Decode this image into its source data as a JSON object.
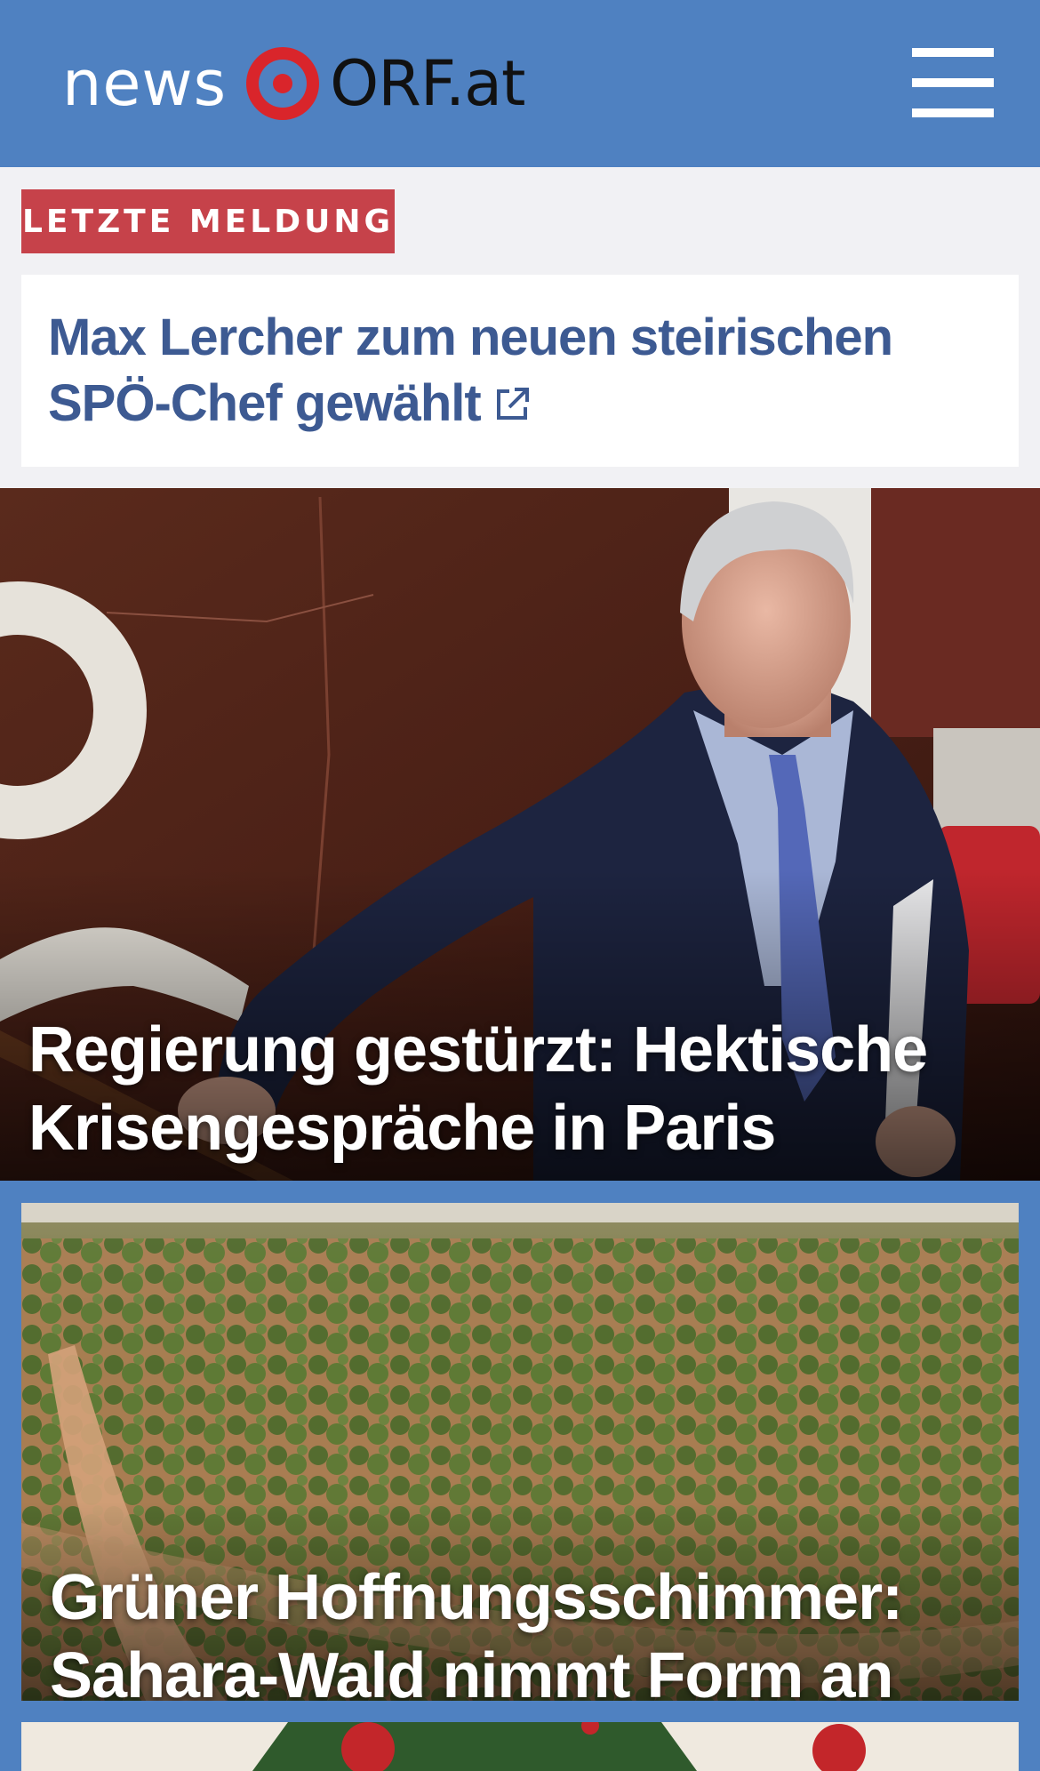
{
  "header": {
    "logo_news": "news",
    "logo_orf": "ORF.at",
    "menu_icon": "hamburger-menu-icon",
    "background": "#4f81c1"
  },
  "latest": {
    "badge": "LETZTE MELDUNG",
    "headline": "Max Lercher zum neuen steirischen SPÖ-Chef gewählt",
    "link_icon": "external-link-icon",
    "badge_color": "#c6424a",
    "headline_color": "#3d5a92"
  },
  "stories": [
    {
      "title": "Regierung gestürzt: Hektische Krisengespräche in Paris"
    },
    {
      "title": "Grüner Hoffnungsschimmer: Sahara-Wald nimmt Form an"
    }
  ]
}
